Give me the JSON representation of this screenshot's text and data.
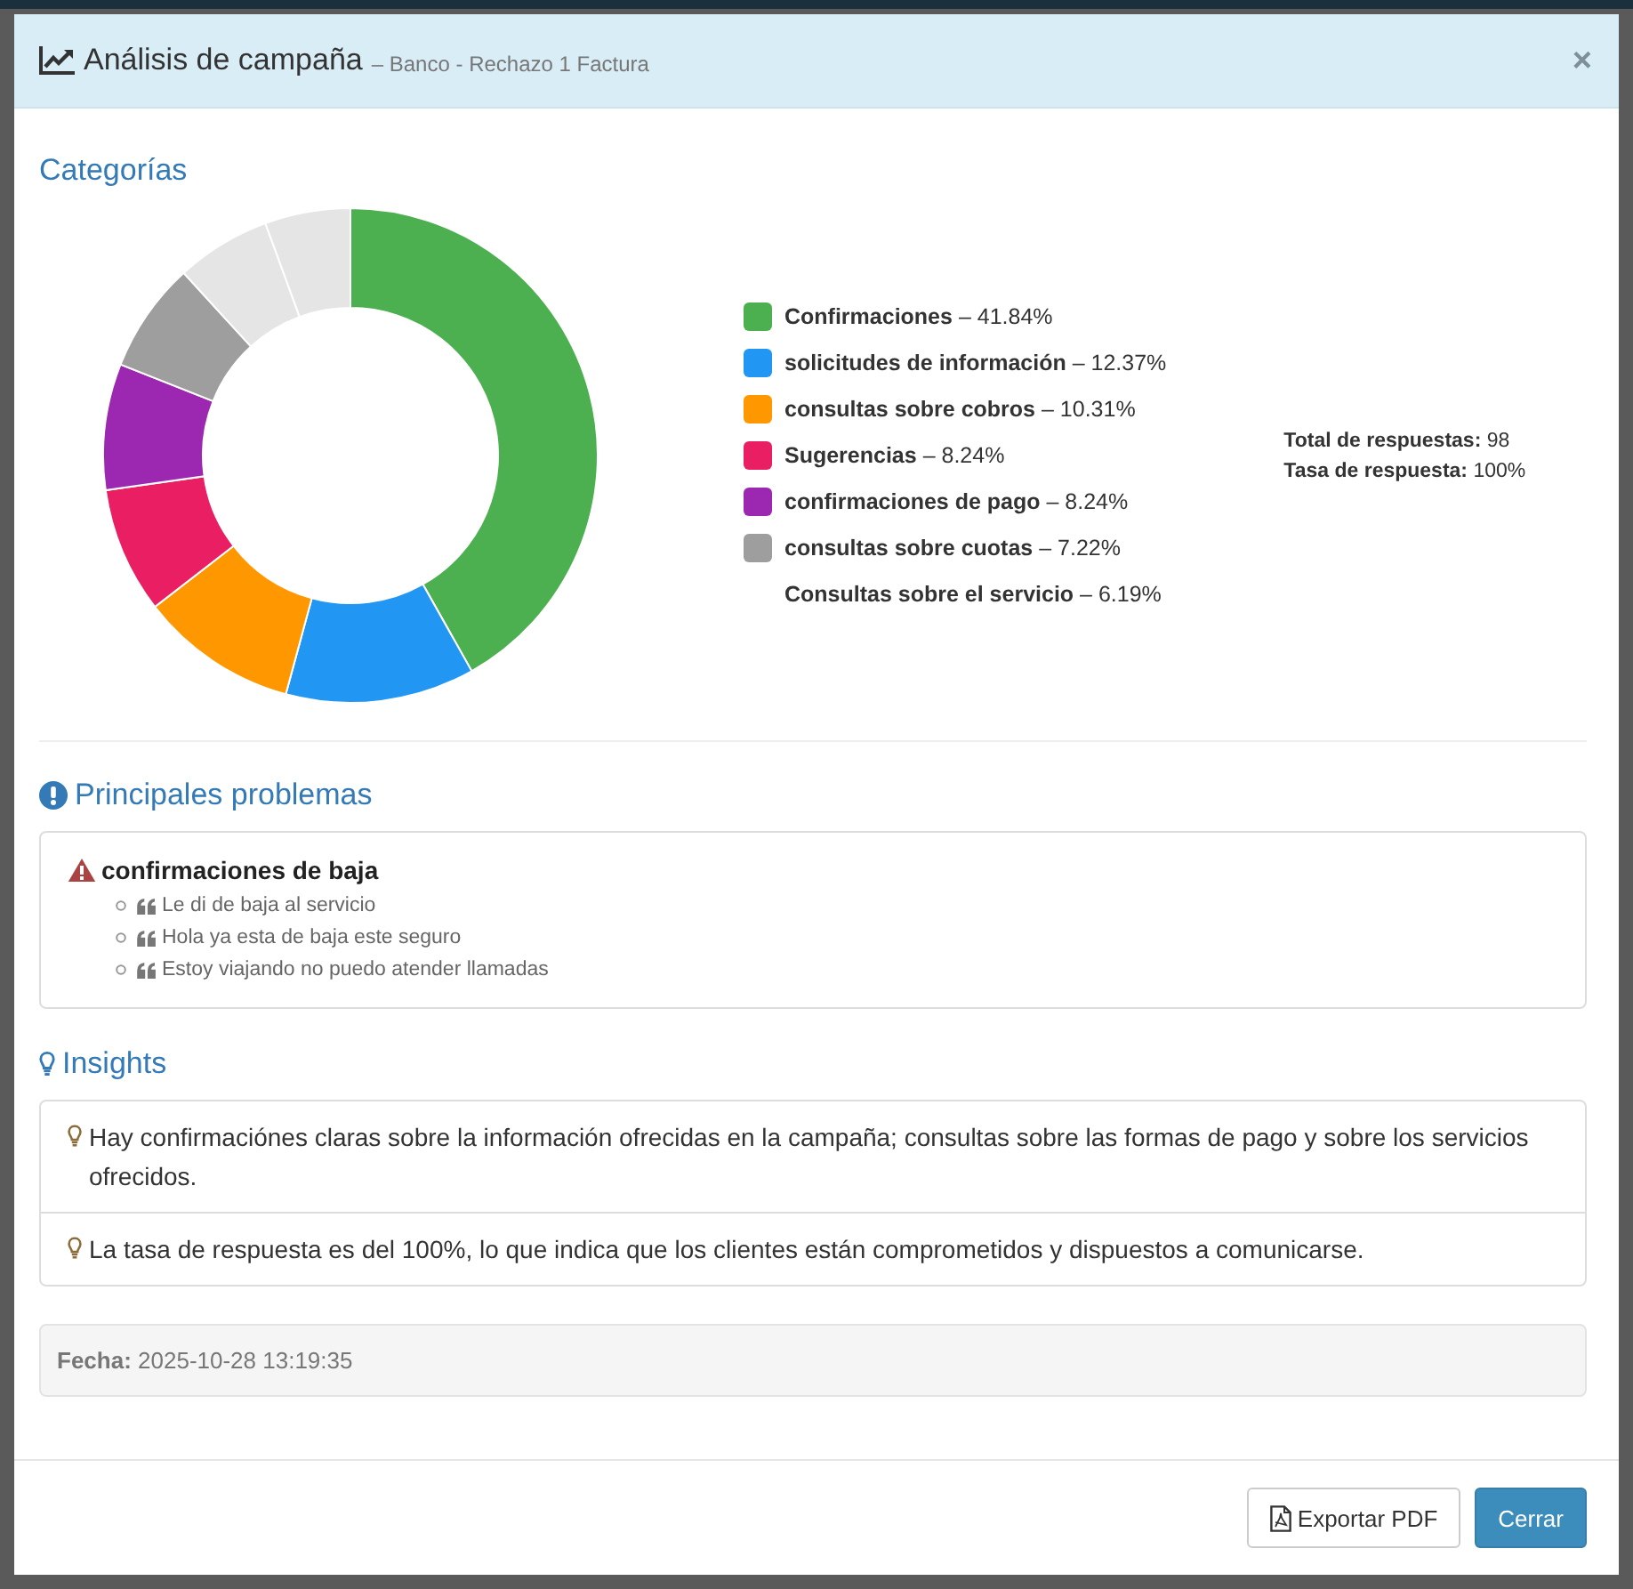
{
  "modal": {
    "title": "Análisis de campaña",
    "subtitle": "– Banco - Rechazo 1 Factura",
    "close": "×"
  },
  "categories": {
    "heading": "Categorías",
    "chart_data": {
      "type": "donut",
      "values": [
        41.84,
        12.37,
        10.31,
        8.24,
        8.24,
        7.22,
        6.19,
        5.59
      ],
      "colors": [
        "#4caf50",
        "#2196f3",
        "#ff9800",
        "#e91e63",
        "#9c27b0",
        "#9e9e9e",
        "#e5e5e5",
        "#e5e5e5"
      ]
    },
    "legend": [
      {
        "text": "**Confirmaciones** – 41.84%",
        "color": "#4caf50"
      },
      {
        "text": "**solicitudes de información** – 12.37%",
        "color": "#2196f3"
      },
      {
        "text": "**consultas sobre cobros** – 10.31%",
        "color": "#ff9800"
      },
      {
        "text": "**Sugerencias** – 8.24%",
        "color": "#e91e63"
      },
      {
        "text": "**confirmaciones de pago** – 8.24%",
        "color": "#9c27b0"
      },
      {
        "text": "**consultas sobre cuotas** – 7.22%",
        "color": "#9e9e9e"
      },
      {
        "text": "**Consultas sobre el servicio** – 6.19%"
      }
    ],
    "stats": [
      "**Total de respuestas:** 98",
      "**Tasa de respuesta:** 100%"
    ]
  },
  "problems": {
    "heading": "Principales problemas",
    "items": [
      {
        "title": "confirmaciones de baja",
        "quotes": [
          "Le di de baja al servicio",
          "Hola ya esta de baja este seguro",
          "Estoy viajando no puedo atender llamadas"
        ]
      }
    ]
  },
  "insights": {
    "heading": "Insights",
    "items": [
      "Hay confirmaciónes claras sobre la información ofrecidas en la campaña; consultas sobre las formas de pago y sobre los servicios ofrecidos.",
      "La tasa de respuesta es del 100%, lo que indica que los clientes están comprometidos y dispuestos a comunicarse."
    ]
  },
  "date": "**Fecha:** 2025-10-28 13:19:35",
  "footer": {
    "buttons": [
      {
        "label": "Exportar PDF",
        "kind": "export"
      },
      {
        "label": "Cerrar",
        "kind": "close"
      }
    ]
  }
}
